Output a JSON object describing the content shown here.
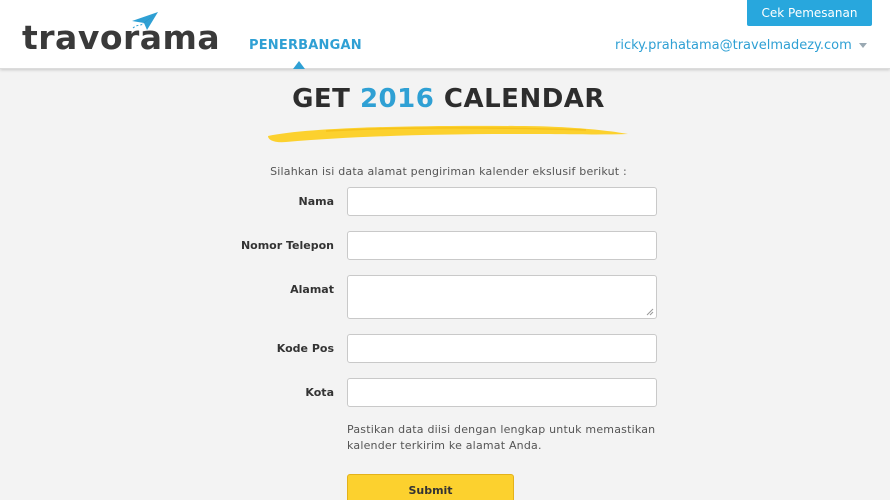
{
  "header": {
    "logo_text": "travorama",
    "nav_flights_label": "PENERBANGAN",
    "check_booking_label": "Cek Pemesanan",
    "user_email": "ricky.prahatama@travelmadezy.com",
    "brand_color": "#2fa0d4",
    "button_color": "#28a7dd"
  },
  "main": {
    "title_prefix": "GET",
    "title_year": "2016",
    "title_suffix": "CALENDAR",
    "intro": "Silahkan isi data alamat pengiriman kalender ekslusif berikut :",
    "fields": [
      {
        "label": "Nama",
        "value": ""
      },
      {
        "label": "Nomor Telepon",
        "value": ""
      },
      {
        "label": "Alamat",
        "value": ""
      },
      {
        "label": "Kode Pos",
        "value": ""
      },
      {
        "label": "Kota",
        "value": ""
      }
    ],
    "note_line1": "Pastikan data diisi dengan lengkap untuk memastikan",
    "note_line2": "kalender terkirim ke alamat Anda.",
    "submit_label": "Submit",
    "accent_yellow": "#fcd12e"
  }
}
